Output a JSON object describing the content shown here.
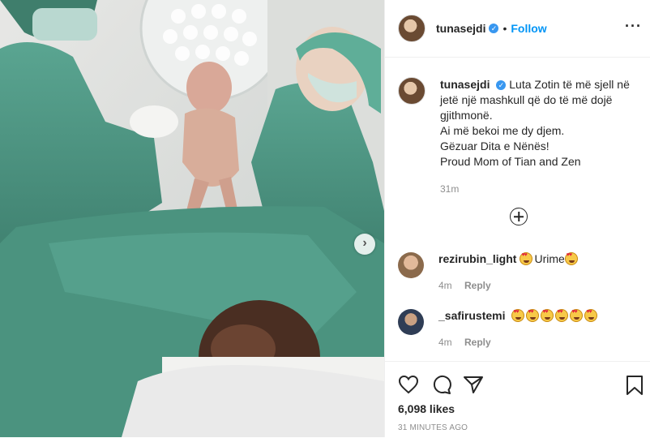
{
  "post": {
    "username": "tunasejdi",
    "verified_mark": "✓",
    "dot": "•",
    "follow": "Follow",
    "more": "···",
    "caption_user": "tunasejdi",
    "caption_lines": [
      "Luta Zotin të më sjell në",
      "jetë një mashkull që do të më dojë",
      "gjithmonë.",
      "Ai më bekoi me dy djem.",
      "Gëzuar Dita e Nënës!",
      "Proud Mom of Tian and Zen"
    ],
    "caption_time": "31m",
    "next_arrow": "›"
  },
  "comments": [
    {
      "username": "rezirubin_light",
      "text": "Urime",
      "time": "4m",
      "reply": "Reply"
    },
    {
      "username": "_safirustemi",
      "text": "",
      "time": "4m",
      "reply": "Reply"
    }
  ],
  "footer": {
    "likes": "6,098 likes",
    "timestamp": "31 MINUTES AGO"
  },
  "icons": {
    "like": "heart-icon",
    "comment": "comment-icon",
    "share": "paper-plane-icon",
    "save": "bookmark-icon",
    "load_more": "plus-circle-icon"
  },
  "colors": {
    "follow": "#0095f6",
    "verified": "#3897f0",
    "scrubs": "#4f9a86",
    "secondary_text": "#8e8e8e"
  }
}
